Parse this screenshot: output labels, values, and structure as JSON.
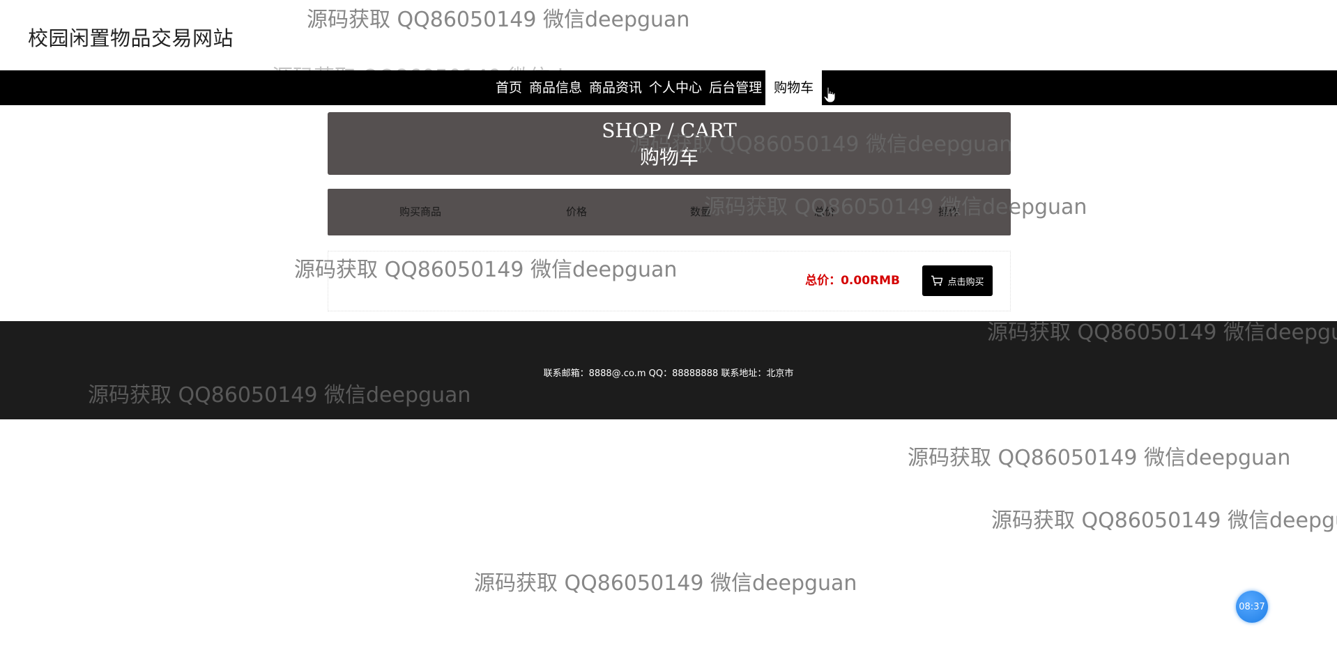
{
  "header": {
    "site_title": "校园闲置物品交易网站"
  },
  "nav": {
    "items": [
      {
        "label": "首页"
      },
      {
        "label": "商品信息"
      },
      {
        "label": "商品资讯"
      },
      {
        "label": "个人中心"
      },
      {
        "label": "后台管理"
      },
      {
        "label": "购物车",
        "active": true
      }
    ]
  },
  "banner": {
    "title_en": "SHOP / CART",
    "title_cn": "购物车"
  },
  "cart": {
    "columns": [
      "购买商品",
      "价格",
      "数量",
      "总价",
      "操作"
    ],
    "total_label": "总价：0.00RMB",
    "buy_button_label": "点击购买"
  },
  "footer": {
    "contact_text": "联系邮箱：8888@.co.m QQ：88888888 联系地址：北京市"
  },
  "watermark_text": "源码获取 QQ86050149 微信deepguan",
  "clock": {
    "time": "08:37"
  },
  "colors": {
    "nav_bg": "#000000",
    "banner_bg": "#555050",
    "footer_bg": "#1c1c1c",
    "total_red": "#d40000",
    "badge_blue": "#1e7ee6"
  }
}
